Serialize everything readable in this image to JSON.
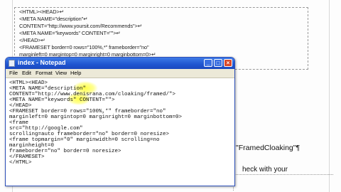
{
  "document": {
    "lines": [
      "<HTML><HEAD>↵",
      "<META NAME=\"description\"↵",
      "CONTENT=\"http://www.yoursit.com/Recommends\">↵",
      "<META NAME=\"keywords\" CONTENT=\"\">↵",
      "</HEAD>↵",
      "<FRAMESET border=0 rows=\"100%,*\" frameborder=\"no\"",
      "marginleft=0 margintop=0 marginright=0 marginbottom=0>↵"
    ],
    "side_text_1": "\"FramedCloaking\"¶",
    "side_text_2": "heck with your"
  },
  "notepad": {
    "title": "index - Notepad",
    "menu": [
      "File",
      "Edit",
      "Format",
      "View",
      "Help"
    ],
    "minimize_glyph": "_",
    "maximize_glyph": "□",
    "close_glyph": "×",
    "code_lines": [
      "<HTML><HEAD>",
      "<META NAME=\"description\"",
      "CONTENT=\"http://www.denisrana.com/cloaking/framed/\">",
      "<META NAME=\"keywords\" CONTENT=\"\">",
      "</HEAD>",
      "<FRAMESET border=0 rows=\"100%,*\" frameborder=\"no\"",
      "marginleft=0 margintop=0 marginright=0 marginbottom=0>",
      "<frame",
      "src=\"http://google.com\"",
      "scrolling=auto frameborder=\"no\" border=0 noresize>",
      "<frame topmargin=\"0\" marginwidth=0 scrolling=no",
      "marginheight=0",
      "frameborder=\"no\" border=0 noresize>",
      "</FRAMESET>",
      "</HTML>"
    ]
  },
  "colors": {
    "titlebar": "#1f55d0",
    "highlight": "#ffff3c",
    "menubar": "#ece9d8"
  }
}
